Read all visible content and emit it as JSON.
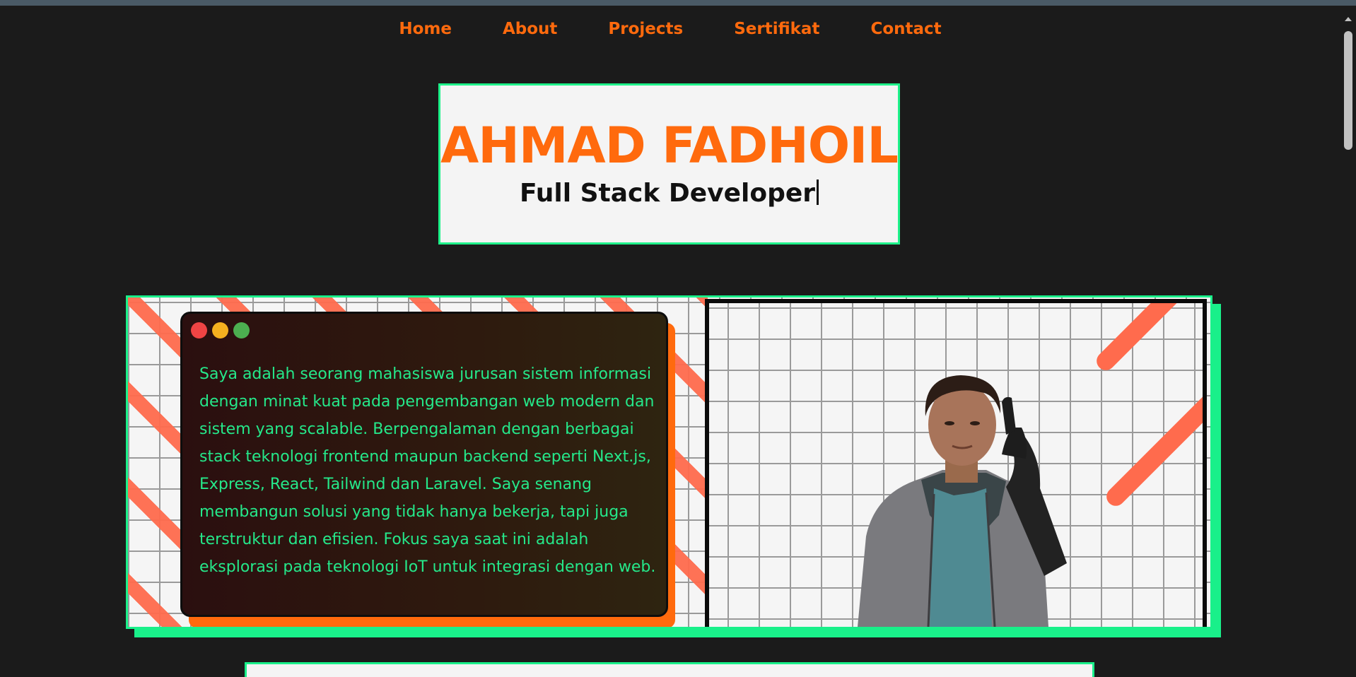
{
  "nav": {
    "items": [
      "Home",
      "About",
      "Projects",
      "Sertifikat",
      "Contact"
    ]
  },
  "hero": {
    "name": "AHMAD FADHOIL",
    "role": "Full Stack Developer"
  },
  "about": {
    "text": "Saya adalah seorang mahasiswa jurusan sistem informasi dengan minat kuat pada pengembangan web modern dan sistem yang scalable. Berpengalaman dengan berbagai stack teknologi frontend maupun backend seperti Next.js, Express, React, Tailwind dan Laravel. Saya senang membangun solusi yang tidak hanya bekerja, tapi juga terstruktur dan efisien. Fokus saya saat ini adalah eksplorasi pada teknologi IoT untuk integrasi dengan web."
  },
  "colors": {
    "accent": "#ff6a0d",
    "border": "#19f08a",
    "background": "#1b1b1b",
    "text_green": "#25e88a"
  }
}
